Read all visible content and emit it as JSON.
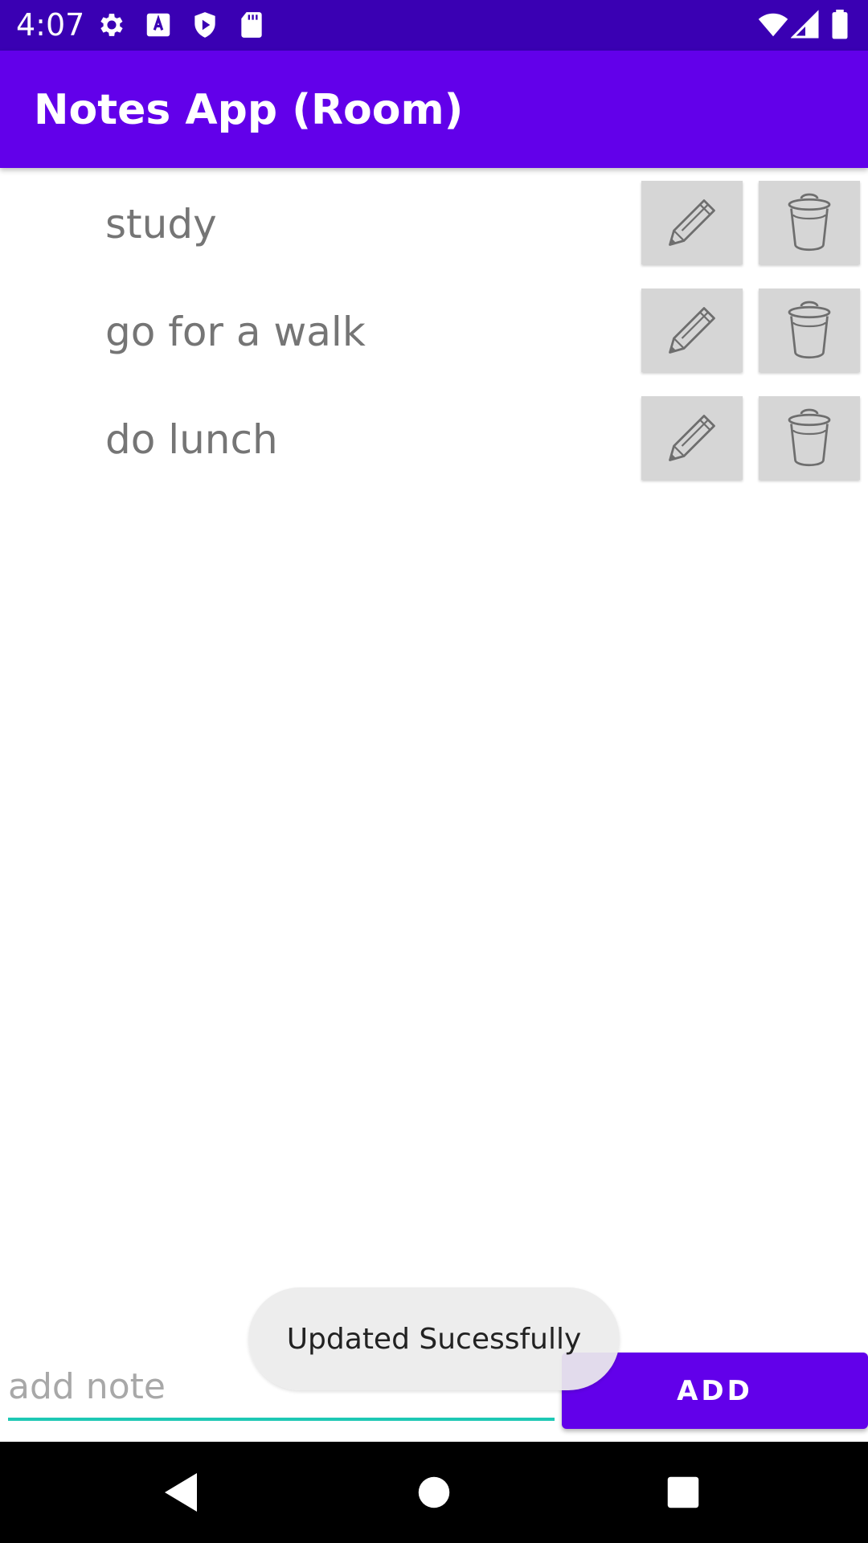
{
  "status_bar": {
    "time": "4:07",
    "left_icons": [
      "settings-gear-icon",
      "accessibility-a-icon",
      "play-protect-icon",
      "sd-card-icon"
    ],
    "right_icons": [
      "wifi-icon",
      "cellular-signal-icon",
      "battery-icon"
    ]
  },
  "app_bar": {
    "title": "Notes App (Room)",
    "color": "#6200ea"
  },
  "notes": [
    {
      "text": "study"
    },
    {
      "text": "go for a walk"
    },
    {
      "text": "do lunch"
    }
  ],
  "note_actions": {
    "edit_icon": "pencil-icon",
    "delete_icon": "trash-icon"
  },
  "input": {
    "placeholder": "add note",
    "value": "",
    "underline_color": "#1ec8b4"
  },
  "add_button": {
    "label": "ADD"
  },
  "toast": {
    "message": "Updated Sucessfully"
  },
  "nav_bar": {
    "buttons": [
      "back-icon",
      "home-icon",
      "recents-icon"
    ]
  }
}
